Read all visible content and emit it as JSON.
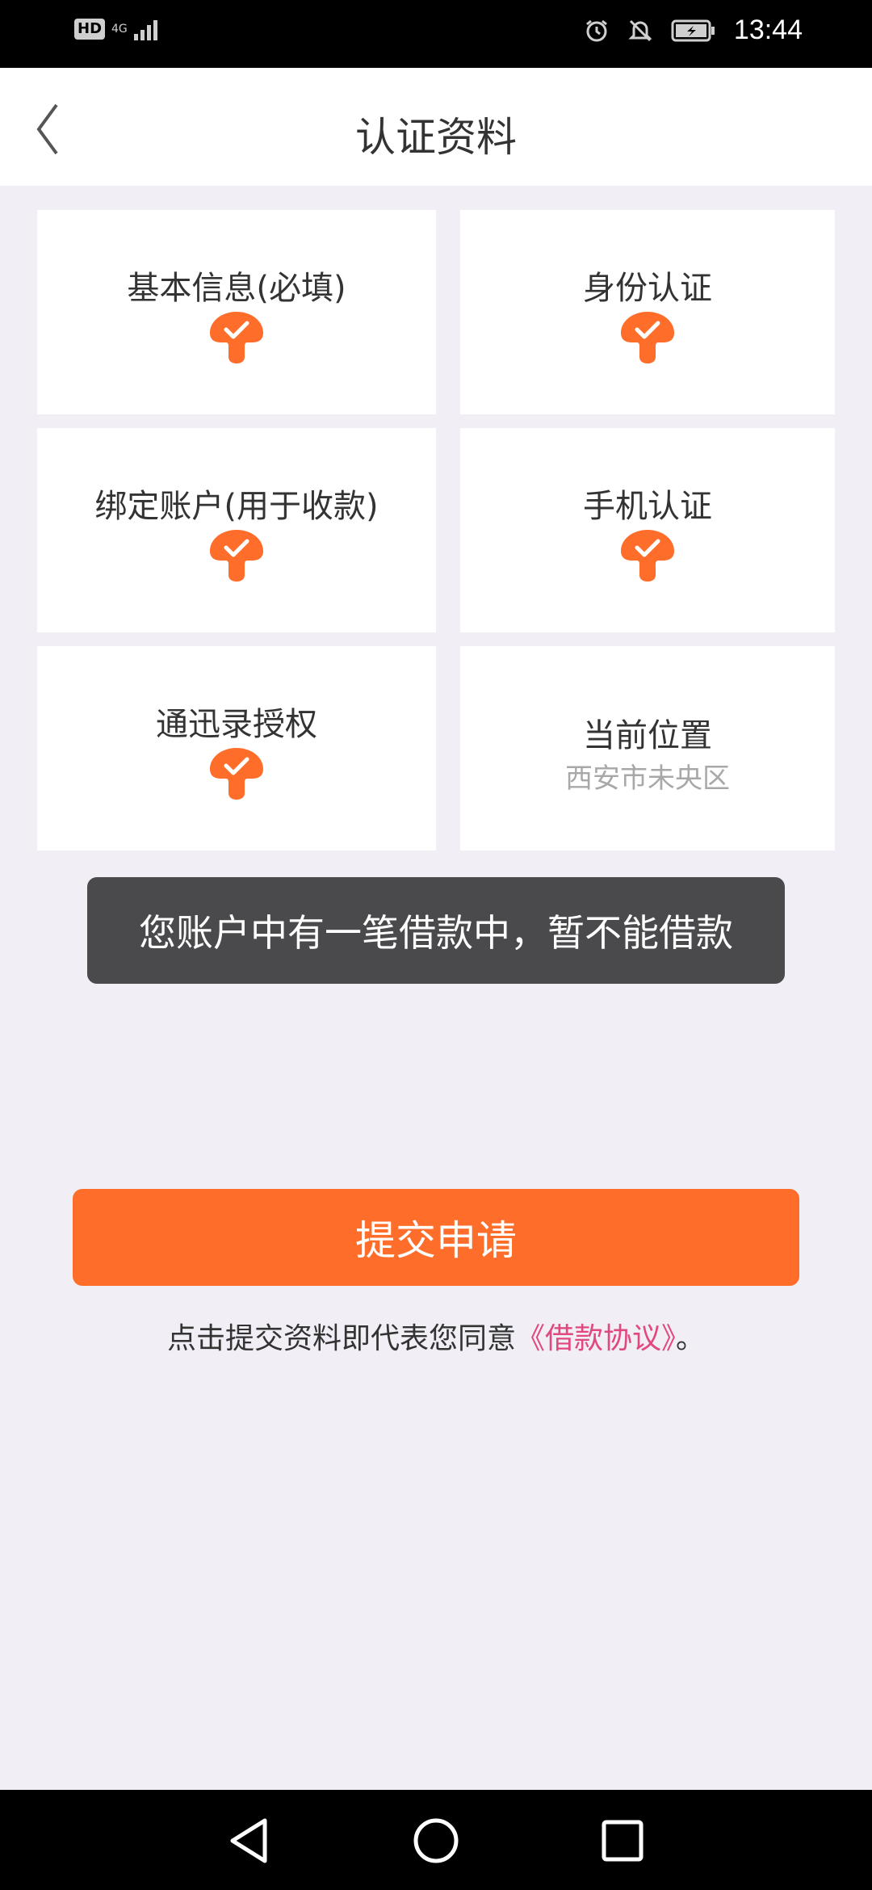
{
  "status_bar": {
    "hd": "HD",
    "network": "4G",
    "time": "13:44"
  },
  "header": {
    "title": "认证资料"
  },
  "cards": [
    {
      "label": "基本信息(必填)",
      "checked": true
    },
    {
      "label": "身份认证",
      "checked": true
    },
    {
      "label": "绑定账户(用于收款)",
      "checked": true
    },
    {
      "label": "手机认证",
      "checked": true
    },
    {
      "label": "通迅录授权",
      "checked": true
    },
    {
      "label": "当前位置",
      "sub": "西安市未央区",
      "checked": false
    }
  ],
  "toast": {
    "message": "您账户中有一笔借款中，暂不能借款"
  },
  "submit_button": {
    "label": "提交申请"
  },
  "agreement": {
    "prefix": "点击提交资料即代表您同意",
    "link": "《借款协议》",
    "suffix": "。"
  },
  "colors": {
    "accent": "#ff6d2a",
    "link": "#e0487f",
    "toast_bg": "#4a4a4c",
    "page_bg": "#f1eff5"
  }
}
